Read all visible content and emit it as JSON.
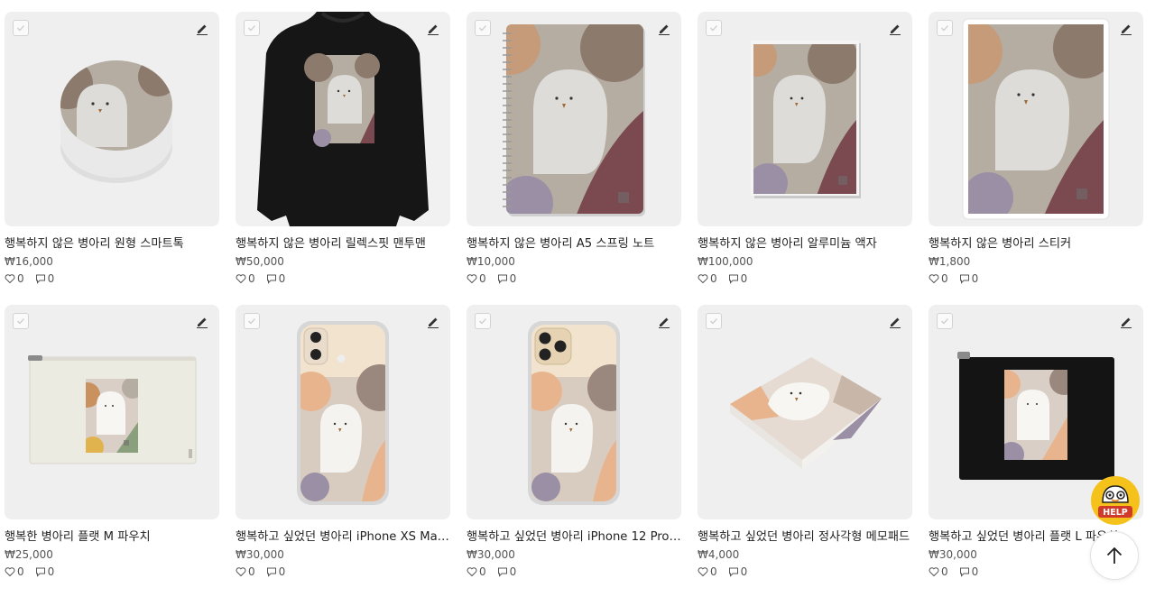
{
  "products": [
    {
      "title": "행복하지 않은 병아리 원형 스마트톡",
      "price": "₩16,000",
      "likes": "0",
      "comments": "0",
      "type": "grip"
    },
    {
      "title": "행복하지 않은 병아리 릴렉스핏 맨투맨",
      "price": "₩50,000",
      "likes": "0",
      "comments": "0",
      "type": "sweatshirt"
    },
    {
      "title": "행복하지 않은 병아리 A5 스프링 노트",
      "price": "₩10,000",
      "likes": "0",
      "comments": "0",
      "type": "notebook"
    },
    {
      "title": "행복하지 않은 병아리 알루미늄 액자",
      "price": "₩100,000",
      "likes": "0",
      "comments": "0",
      "type": "frame"
    },
    {
      "title": "행복하지 않은 병아리 스티커",
      "price": "₩1,800",
      "likes": "0",
      "comments": "0",
      "type": "sticker"
    },
    {
      "title": "행복한 병아리 플랫 M 파우치",
      "price": "₩25,000",
      "likes": "0",
      "comments": "0",
      "type": "pouch-cream"
    },
    {
      "title": "행복하고 싶었던 병아리 iPhone XS Max ...",
      "price": "₩30,000",
      "likes": "0",
      "comments": "0",
      "type": "phone-xs"
    },
    {
      "title": "행복하고 싶었던 병아리 iPhone 12 Pro ...",
      "price": "₩30,000",
      "likes": "0",
      "comments": "0",
      "type": "phone-12"
    },
    {
      "title": "행복하고 싶었던 병아리 정사각형 메모패드",
      "price": "₩4,000",
      "likes": "0",
      "comments": "0",
      "type": "memopad"
    },
    {
      "title": "행복하고 싶었던 병아리 플랫 L 파우치",
      "price": "₩30,000",
      "likes": "0",
      "comments": "0",
      "type": "pouch-black"
    }
  ],
  "help_badge": {
    "label": "HELP"
  },
  "colors": {
    "thumb_bg": "#efefef",
    "art_bg": "#b5aca2",
    "blob_brown": "#8c7a6c",
    "blob_wine": "#7a4a50",
    "blob_lilac": "#9b8fa6",
    "ghost": "#dddcd8",
    "peach": "#e8b48e",
    "help_yellow": "#f4c21b"
  },
  "icons": {
    "checkbox": "check-icon",
    "edit": "pencil-icon",
    "like": "heart-icon",
    "comment": "speech-bubble-icon",
    "top": "arrow-up-icon"
  }
}
